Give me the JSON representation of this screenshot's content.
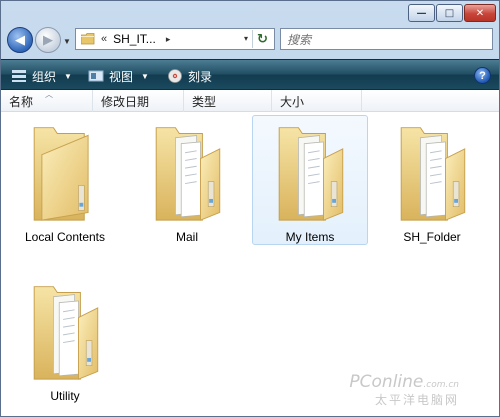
{
  "window": {
    "buttons": {
      "minimize": "—",
      "maximize": "□",
      "close": "✕"
    }
  },
  "nav": {
    "back_icon": "back-arrow-icon",
    "forward_icon": "forward-arrow-icon",
    "address": {
      "separator": "«",
      "path": "SH_IT...",
      "arrow": "▸",
      "dropdown": "▾",
      "refresh": "↻"
    },
    "search": {
      "placeholder": "搜索"
    }
  },
  "toolbar": {
    "organize": "组织",
    "view": "视图",
    "burn": "刻录",
    "help": "?"
  },
  "columns": [
    "名称",
    "修改日期",
    "类型",
    "大小"
  ],
  "items": [
    {
      "label": "Local Contents",
      "icon": "folder-empty-icon"
    },
    {
      "label": "Mail",
      "icon": "folder-with-documents-icon"
    },
    {
      "label": "My Items",
      "icon": "folder-with-documents-icon"
    },
    {
      "label": "SH_Folder",
      "icon": "folder-with-documents-icon"
    },
    {
      "label": "Utility",
      "icon": "folder-with-documents-icon"
    }
  ],
  "watermark": {
    "main": "PConline",
    "sub": ".com.cn",
    "cn": "太平洋电脑网"
  },
  "colors": {
    "command_bar": "#1f4c61",
    "folder": "#f2d98a",
    "hover_bg": "#e3f0fc"
  }
}
